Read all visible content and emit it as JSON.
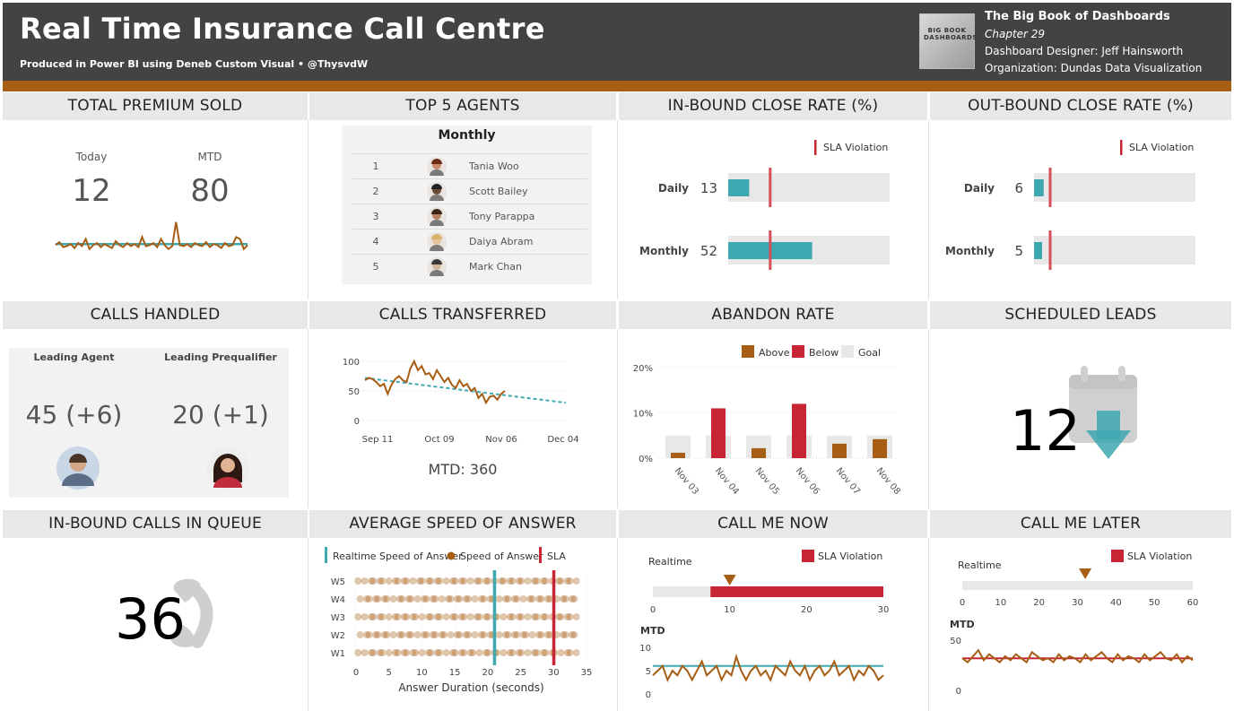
{
  "header": {
    "title": "Real Time Insurance Call Centre",
    "subtitle": "Produced in Power BI using Deneb Custom Visual • @ThysvdW",
    "book_cover_text": "BIG BOOK DASHBOARDS",
    "book_title": "The Big Book of Dashboards",
    "chapter": "Chapter 29",
    "designer": "Dashboard Designer: Jeff Hainsworth",
    "organization": "Organization: Dundas Data Visualization"
  },
  "colors": {
    "teal": "#3ea8b0",
    "brown": "#a65d14",
    "red": "#c72533",
    "grey": "#e8e8e8",
    "header_bg": "#434343"
  },
  "tiles": {
    "total_premium": {
      "title": "TOTAL PREMIUM SOLD",
      "today_label": "Today",
      "today_value": "12",
      "mtd_label": "MTD",
      "mtd_value": "80"
    },
    "top_agents": {
      "title": "TOP 5 AGENTS",
      "table_title": "Monthly",
      "agents": [
        {
          "rank": "1",
          "name": "Tania Woo",
          "avatar": "avatar-icon"
        },
        {
          "rank": "2",
          "name": "Scott Bailey",
          "avatar": "avatar-icon"
        },
        {
          "rank": "3",
          "name": "Tony Parappa",
          "avatar": "avatar-icon"
        },
        {
          "rank": "4",
          "name": "Daiya Abram",
          "avatar": "avatar-icon"
        },
        {
          "rank": "5",
          "name": "Mark Chan",
          "avatar": "avatar-icon"
        }
      ]
    },
    "inbound_close": {
      "title": "IN-BOUND CLOSE RATE (%)",
      "legend": "SLA Violation",
      "rows": [
        {
          "label": "Daily",
          "value": 13
        },
        {
          "label": "Monthly",
          "value": 52
        }
      ],
      "sla": 26,
      "max": 100
    },
    "outbound_close": {
      "title": "OUT-BOUND CLOSE RATE (%)",
      "legend": "SLA Violation",
      "rows": [
        {
          "label": "Daily",
          "value": 6
        },
        {
          "label": "Monthly",
          "value": 5
        }
      ],
      "sla": 10,
      "max": 100
    },
    "calls_handled": {
      "title": "CALLS HANDLED",
      "agent_label": "Leading Agent",
      "agent_value": "45 (+6)",
      "prequalifier_label": "Leading Prequalifier",
      "prequalifier_value": "20 (+1)"
    },
    "calls_transferred": {
      "title": "CALLS TRANSFERRED",
      "mtd": "MTD: 360"
    },
    "abandon_rate": {
      "title": "ABANDON RATE",
      "legend": [
        "Above",
        "Below",
        "Goal"
      ]
    },
    "scheduled_leads": {
      "title": "SCHEDULED LEADS",
      "value": "12",
      "icon": "calendar-down-icon"
    },
    "calls_in_queue": {
      "title": "IN-BOUND CALLS IN QUEUE",
      "value": "36",
      "icon": "phone-icon"
    },
    "speed_of_answer": {
      "title": "AVERAGE SPEED OF ANSWER",
      "legend": [
        "Realtime Speed of Answer",
        "Speed of Answer",
        "SLA"
      ]
    },
    "call_me_now": {
      "title": "CALL ME NOW",
      "realtime_label": "Realtime",
      "legend": "SLA Violation",
      "mtd_label": "MTD"
    },
    "call_me_later": {
      "title": "CALL ME LATER",
      "realtime_label": "Realtime",
      "legend": "SLA Violation",
      "mtd_label": "MTD"
    }
  },
  "chart_data": [
    {
      "id": "premium_spark",
      "type": "line",
      "series": [
        {
          "values": [
            22,
            25,
            20,
            21,
            23,
            19,
            24,
            21,
            28,
            18,
            22,
            24,
            20,
            23,
            21,
            19,
            26,
            22,
            20,
            24,
            21,
            23,
            20,
            30,
            21,
            22,
            24,
            20,
            28,
            22,
            18,
            21,
            45,
            22,
            21,
            23,
            20,
            24,
            22,
            21,
            25,
            20,
            23,
            22,
            19,
            24,
            21,
            22,
            30,
            28,
            18,
            22
          ]
        },
        {
          "values": [
            23,
            23
          ]
        }
      ]
    },
    {
      "id": "calls_transferred",
      "type": "line",
      "x": [
        "Sep 11",
        "Oct 09",
        "Nov 06",
        "Dec 04"
      ],
      "ylim": [
        0,
        100
      ],
      "yticks": [
        0,
        50,
        100
      ],
      "series": [
        {
          "values": [
            68,
            72,
            70,
            65,
            58,
            62,
            45,
            60,
            70,
            75,
            68,
            65,
            88,
            100,
            85,
            92,
            78,
            80,
            70,
            85,
            75,
            65,
            72,
            60,
            55,
            68,
            58,
            62,
            50,
            55,
            38,
            45,
            30,
            40,
            42,
            35,
            45,
            50
          ]
        },
        {
          "values": [
            72,
            30
          ]
        }
      ]
    },
    {
      "id": "abandon_rate",
      "type": "bar",
      "categories": [
        "Nov 03",
        "Nov 04",
        "Nov 05",
        "Nov 06",
        "Nov 07",
        "Nov 08"
      ],
      "ylim": [
        0,
        20
      ],
      "yticks": [
        "0%",
        "10%",
        "20%"
      ],
      "goal": [
        5,
        5,
        5,
        5,
        5,
        5
      ],
      "values": [
        1.2,
        11,
        2.2,
        12,
        3.2,
        4.2
      ],
      "status": [
        "Above",
        "Below",
        "Above",
        "Below",
        "Above",
        "Above"
      ]
    },
    {
      "id": "speed_of_answer",
      "type": "scatter",
      "categories": [
        "W1",
        "W2",
        "W3",
        "W4",
        "W5"
      ],
      "xlim": [
        0,
        35
      ],
      "xticks": [
        0,
        5,
        10,
        15,
        20,
        25,
        30,
        35
      ],
      "xlabel": "Answer Duration (seconds)",
      "realtime": 21,
      "sla": 30
    },
    {
      "id": "call_me_now_bullet",
      "type": "bar",
      "xlim": [
        0,
        30
      ],
      "xticks": [
        0,
        10,
        20,
        30
      ],
      "sla_start": 7.5,
      "realtime": 10
    },
    {
      "id": "call_me_now_mtd",
      "type": "line",
      "ylim": [
        0,
        10
      ],
      "yticks": [
        0,
        5,
        10
      ],
      "series": [
        {
          "values": [
            4,
            5,
            6,
            3,
            5,
            4,
            6,
            5,
            3,
            5,
            7,
            4,
            5,
            6,
            3,
            5,
            4,
            8,
            5,
            3,
            5,
            6,
            4,
            5,
            3,
            6,
            5,
            4,
            7,
            5,
            4,
            6,
            3,
            5,
            6,
            4,
            5,
            7,
            4,
            5,
            6,
            3,
            5,
            4,
            6,
            5,
            3,
            4
          ]
        },
        {
          "values": [
            6,
            6
          ]
        }
      ]
    },
    {
      "id": "call_me_later_bullet",
      "type": "bar",
      "xlim": [
        0,
        60
      ],
      "xticks": [
        0,
        10,
        20,
        30,
        40,
        50,
        60
      ],
      "realtime": 32
    },
    {
      "id": "call_me_later_mtd",
      "type": "line",
      "ylim": [
        0,
        50
      ],
      "yticks": [
        0,
        50
      ],
      "series": [
        {
          "values": [
            32,
            28,
            34,
            40,
            30,
            36,
            32,
            28,
            34,
            30,
            36,
            32,
            28,
            38,
            34,
            30,
            32,
            28,
            36,
            30,
            34,
            32,
            28,
            36,
            30,
            34,
            38,
            32,
            28,
            36,
            30,
            34,
            32,
            28,
            36,
            30,
            34,
            38,
            32,
            30,
            36,
            28,
            34,
            30
          ]
        },
        {
          "values": [
            32,
            32
          ]
        }
      ]
    }
  ]
}
